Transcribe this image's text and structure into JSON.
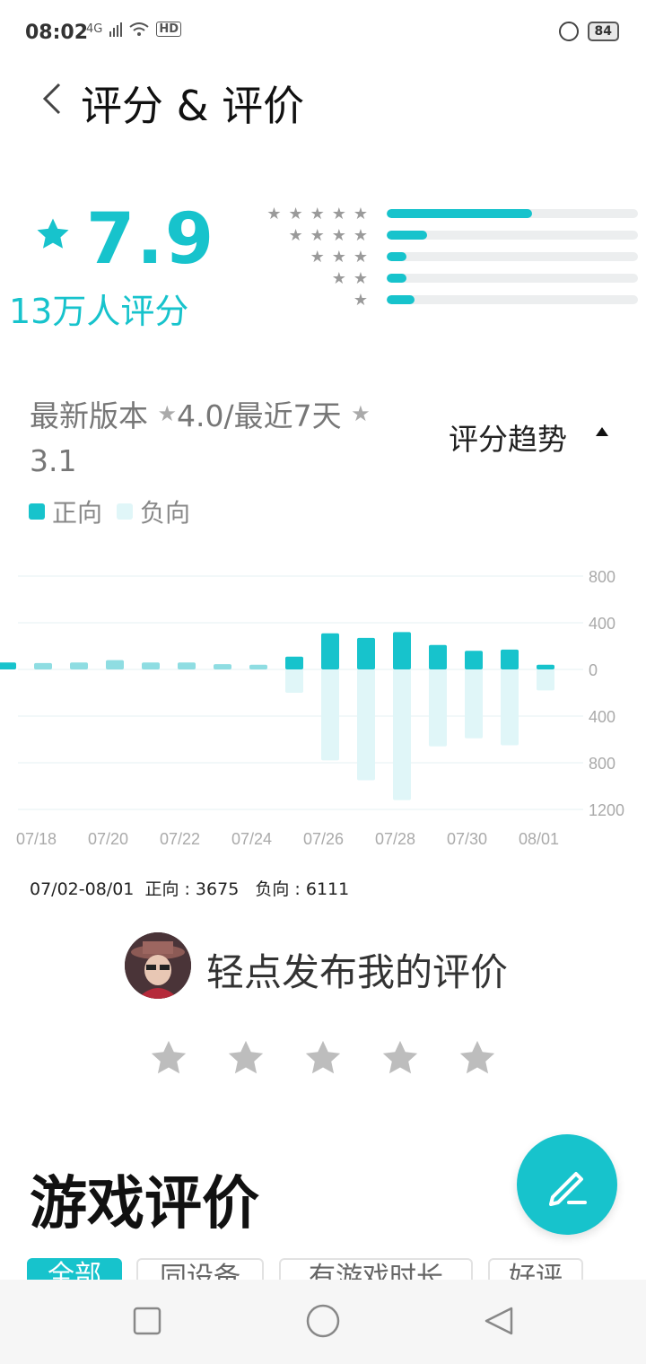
{
  "status": {
    "time": "08:02",
    "network": "4G",
    "hd": "HD",
    "battery": "84"
  },
  "header": {
    "back_icon": "chevron-left-icon",
    "title": "评分 & 评价"
  },
  "summary": {
    "score": "7.9",
    "count": "13万人评分",
    "distribution": [
      {
        "stars": 5,
        "fraction": 0.58
      },
      {
        "stars": 4,
        "fraction": 0.16
      },
      {
        "stars": 3,
        "fraction": 0.08
      },
      {
        "stars": 2,
        "fraction": 0.08
      },
      {
        "stars": 1,
        "fraction": 0.11
      }
    ],
    "accent": "#17c3cc"
  },
  "version": {
    "latest_label": "最新版本",
    "latest_score": "4.0",
    "sep": "/最近7天",
    "recent_score": "3.1"
  },
  "trend_label": "评分趋势",
  "legend": {
    "positive": "正向",
    "negative": "负向"
  },
  "chart_data": {
    "type": "bar",
    "categories": [
      "07/17",
      "07/18",
      "07/19",
      "07/20",
      "07/21",
      "07/22",
      "07/23",
      "07/24",
      "07/25",
      "07/26",
      "07/27",
      "07/28",
      "07/29",
      "07/30",
      "07/31",
      "08/01"
    ],
    "x_tick_labels": [
      "07/18",
      "07/20",
      "07/22",
      "07/24",
      "07/26",
      "07/28",
      "07/30",
      "08/01"
    ],
    "y_tick_labels": [
      "800",
      "400",
      "0",
      "400",
      "800",
      "1200"
    ],
    "series": [
      {
        "name": "正向",
        "values": [
          60,
          55,
          60,
          80,
          60,
          60,
          45,
          40,
          110,
          310,
          270,
          320,
          210,
          160,
          170,
          40
        ],
        "color": "#17c3cc"
      },
      {
        "name": "负向",
        "values": [
          0,
          0,
          0,
          0,
          0,
          0,
          0,
          0,
          -200,
          -780,
          -950,
          -1120,
          -660,
          -590,
          -650,
          -180
        ],
        "color": "#e0f6f8"
      }
    ],
    "ylim": [
      -1200,
      800
    ]
  },
  "period_summary": "07/02-08/01  正向 : 3675   负向 : 6111",
  "prompt": {
    "text": "轻点发布我的评价",
    "avatar_icon": "user-avatar"
  },
  "section_title": "游戏评价",
  "chips": [
    "全部",
    "同设备",
    "有游戏时长",
    "好评"
  ],
  "nav": {
    "recent": "square-icon",
    "home": "circle-icon",
    "back": "triangle-back-icon"
  }
}
